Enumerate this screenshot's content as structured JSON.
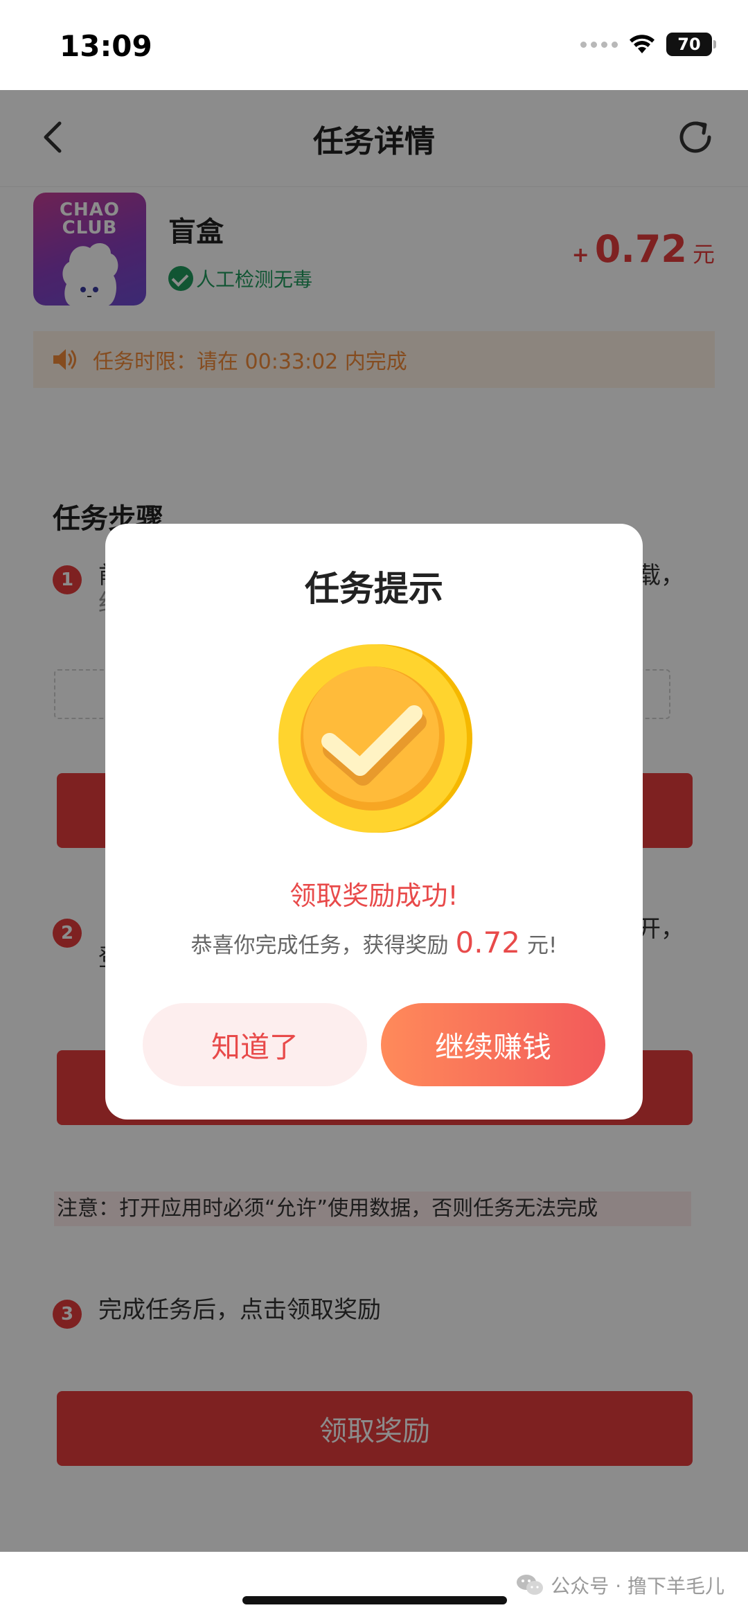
{
  "status_bar": {
    "time": "13:09",
    "battery": "70"
  },
  "header": {
    "title": "任务详情"
  },
  "app": {
    "logo_text_line1": "CHAO",
    "logo_text_line2": "CLUB",
    "name": "盲盒",
    "safe_label": "人工检测无毒",
    "reward_plus": "+",
    "reward_amount": "0.72",
    "reward_unit": "元"
  },
  "notice": {
    "text": "任务时限：请在 00:33:02 内完成"
  },
  "steps": {
    "title": "任务步骤",
    "step1": {
      "num": "1",
      "text_left": "前",
      "text_left2": "红",
      "text_right": "载，"
    },
    "step2": {
      "num": "2",
      "text_left": "登",
      "text_right": "开，"
    },
    "note": "注意：打开应用时必须“允许”使用数据，否则任务无法完成",
    "step3": {
      "num": "3",
      "text": "完成任务后，点击领取奖励"
    },
    "claim_button": "领取奖励"
  },
  "modal": {
    "title": "任务提示",
    "success": "领取奖励成功!",
    "congrats_prefix": "恭喜你完成任务，获得奖励",
    "congrats_amount": "0.72",
    "congrats_suffix": "元!",
    "btn_know": "知道了",
    "btn_continue": "继续赚钱"
  },
  "watermark": {
    "text": "公众号 · 撸下羊毛儿"
  },
  "colors": {
    "accent": "#e63c3c",
    "success_green": "#1f9c5e",
    "coin_gold": "#ffc928",
    "notice_orange": "#f28a3a"
  },
  "icons": [
    "chevron-left-icon",
    "refresh-icon",
    "check-circle-icon",
    "speaker-icon",
    "coin-check-icon",
    "wechat-icon"
  ]
}
